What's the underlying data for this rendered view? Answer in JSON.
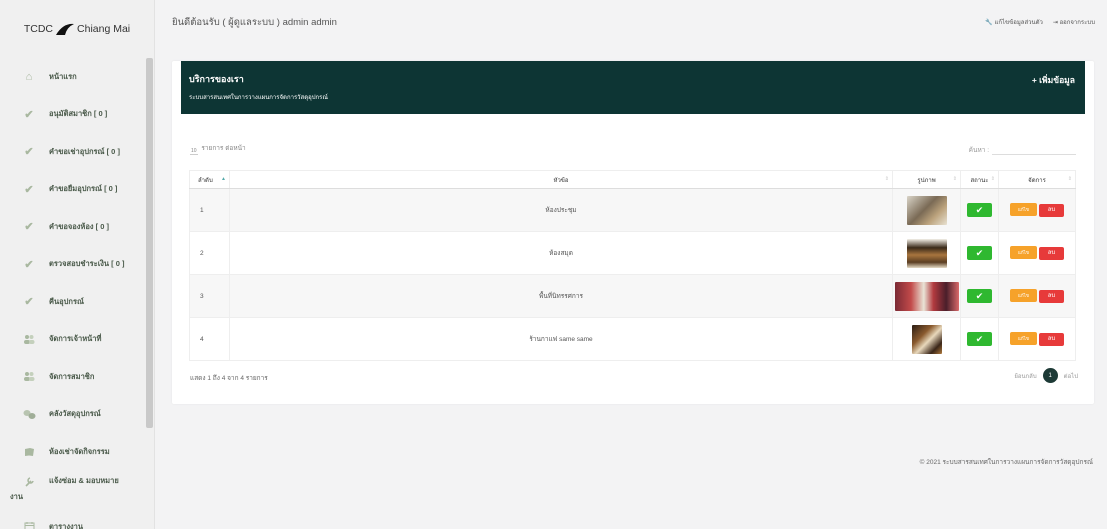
{
  "brand": {
    "text": "TCDC",
    "city": "Chiang Mai"
  },
  "sidebar": {
    "items": [
      {
        "label": "หน้าแรก",
        "icon": "home-icon"
      },
      {
        "label": "อนุมัติสมาชิก [ 0 ]",
        "icon": "check-icon"
      },
      {
        "label": "คำขอเช่าอุปกรณ์ [ 0 ]",
        "icon": "check-icon"
      },
      {
        "label": "คำขอยืมอุปกรณ์ [ 0 ]",
        "icon": "check-icon"
      },
      {
        "label": "คำขอจองห้อง [ 0 ]",
        "icon": "check-icon"
      },
      {
        "label": "ตรวจสอบชำระเงิน [ 0 ]",
        "icon": "check-icon"
      },
      {
        "label": "คืนอุปกรณ์",
        "icon": "check-icon"
      },
      {
        "label": "จัดการเจ้าหน้าที่",
        "icon": "users-icon"
      },
      {
        "label": "จัดการสมาชิก",
        "icon": "users-icon"
      },
      {
        "label": "คลังวัสดุอุปกรณ์",
        "icon": "stack-icon"
      },
      {
        "label": "ห้องเช่าจัดกิจกรรม",
        "icon": "book-icon"
      },
      {
        "label": "แจ้งซ่อม & มอบหมาย",
        "label2": "งาน",
        "icon": "wrench-icon"
      },
      {
        "label": "ตารางงาน",
        "icon": "calendar-icon"
      }
    ]
  },
  "header": {
    "welcome": "ยินดีต้อนรับ ( ผู้ดูแลระบบ ) admin admin",
    "edit_profile": "แก้ไขข้อมูลส่วนตัว",
    "logout": "ออกจากระบบ"
  },
  "panel": {
    "title": "บริการของเรา",
    "subtitle": "ระบบสารสนเทศในการวางแผนการจัดการวัสดุอุปกรณ์",
    "add_label": "+ เพิ่มข้อมูล",
    "length_value": "10",
    "length_label": "รายการ ต่อหน้า",
    "search_label": "ค้นหา :",
    "search_value": ""
  },
  "table": {
    "headers": {
      "no": "ลำดับ",
      "title": "หัวข้อ",
      "image": "รูปภาพ",
      "status": "สถานะ",
      "manage": "จัดการ"
    },
    "rows": [
      {
        "no": "1",
        "title": "ห้องประชุม"
      },
      {
        "no": "2",
        "title": "ห้องสมุด"
      },
      {
        "no": "3",
        "title": "พื้นที่นิทรรศการ"
      },
      {
        "no": "4",
        "title": "ร้านกาแฟ same same"
      }
    ],
    "edit_label": "แก้ไข",
    "delete_label": "ลบ",
    "info": "แสดง 1 ถึง 4 จาก 4 รายการ",
    "prev": "ย้อนกลับ",
    "page": "1",
    "next": "ต่อไป"
  },
  "footer": "© 2021 ระบบสารสนเทศในการวางแผนการจัดการวัสดุอุปกรณ์",
  "colors": {
    "panel_header": "#0d3534",
    "ok": "#2fb830",
    "edit": "#f6a22a",
    "delete": "#e73a3a",
    "page_active": "#1d3a36"
  }
}
